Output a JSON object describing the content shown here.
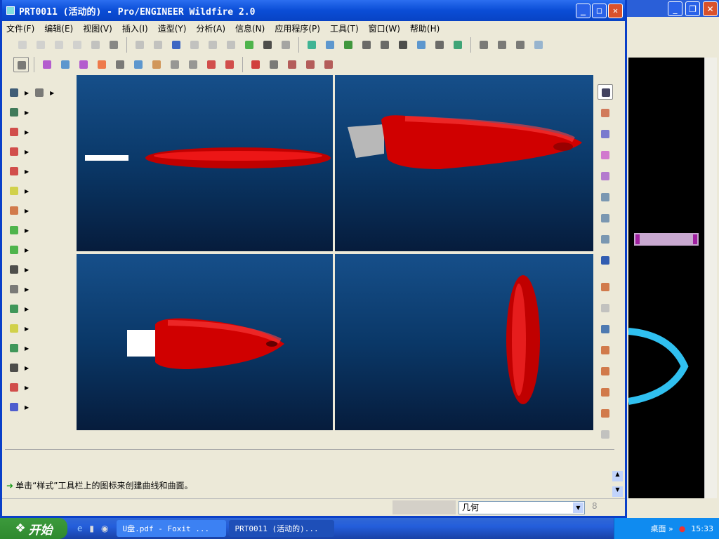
{
  "window": {
    "title": "PRT0011 (活动的) - Pro/ENGINEER Wildfire 2.0"
  },
  "menu": [
    "文件(F)",
    "编辑(E)",
    "视图(V)",
    "插入(I)",
    "造型(Y)",
    "分析(A)",
    "信息(N)",
    "应用程序(P)",
    "工具(T)",
    "窗口(W)",
    "帮助(H)"
  ],
  "message": {
    "text": "单击“样式”工具栏上的图标来创建曲线和曲面。"
  },
  "status": {
    "filter_value": "几何"
  },
  "taskbar": {
    "start_label": "开始",
    "tasks": [
      "U盘.pdf - Foxit ...",
      "PRT0011 (活动的)..."
    ],
    "tray_label": "桌面 »",
    "clock": "15:33"
  },
  "colors": {
    "accent": "#0a4dd6",
    "model": "#d00000",
    "viewport_top": "#164f8a",
    "viewport_bottom": "#061c3c"
  }
}
